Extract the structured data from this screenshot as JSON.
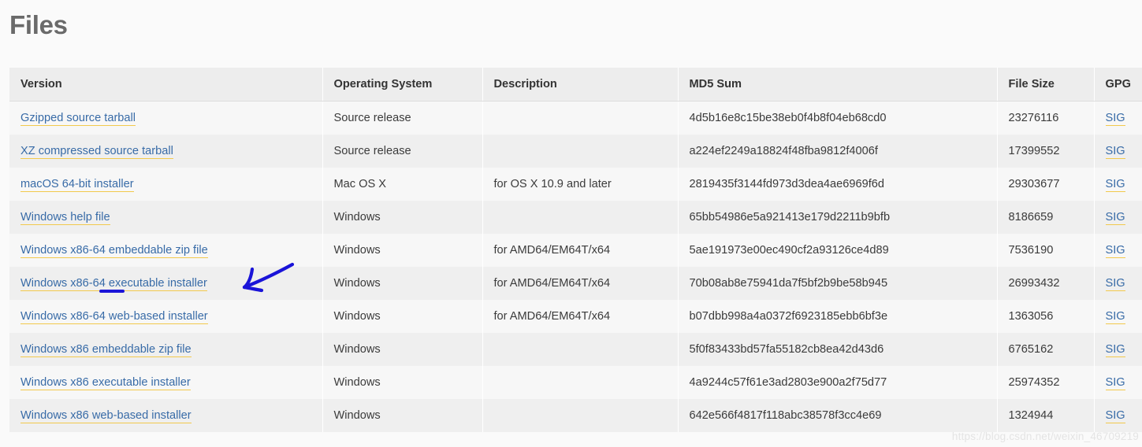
{
  "page": {
    "title": "Files",
    "watermark": "https://blog.csdn.net/weixin_46709219"
  },
  "table": {
    "columns": [
      "Version",
      "Operating System",
      "Description",
      "MD5 Sum",
      "File Size",
      "GPG"
    ],
    "rows": [
      {
        "version": "Gzipped source tarball",
        "os": "Source release",
        "description": "",
        "md5": "4d5b16e8c15be38eb0f4b8f04eb68cd0",
        "size": "23276116",
        "gpg": "SIG"
      },
      {
        "version": "XZ compressed source tarball",
        "os": "Source release",
        "description": "",
        "md5": "a224ef2249a18824f48fba9812f4006f",
        "size": "17399552",
        "gpg": "SIG"
      },
      {
        "version": "macOS 64-bit installer",
        "os": "Mac OS X",
        "description": "for OS X 10.9 and later",
        "md5": "2819435f3144fd973d3dea4ae6969f6d",
        "size": "29303677",
        "gpg": "SIG"
      },
      {
        "version": "Windows help file",
        "os": "Windows",
        "description": "",
        "md5": "65bb54986e5a921413e179d2211b9bfb",
        "size": "8186659",
        "gpg": "SIG"
      },
      {
        "version": "Windows x86-64 embeddable zip file",
        "os": "Windows",
        "description": "for AMD64/EM64T/x64",
        "md5": "5ae191973e00ec490cf2a93126ce4d89",
        "size": "7536190",
        "gpg": "SIG"
      },
      {
        "version": "Windows x86-64 executable installer",
        "os": "Windows",
        "description": "for AMD64/EM64T/x64",
        "md5": "70b08ab8e75941da7f5bf2b9be58b945",
        "size": "26993432",
        "gpg": "SIG"
      },
      {
        "version": "Windows x86-64 web-based installer",
        "os": "Windows",
        "description": "for AMD64/EM64T/x64",
        "md5": "b07dbb998a4a0372f6923185ebb6bf3e",
        "size": "1363056",
        "gpg": "SIG"
      },
      {
        "version": "Windows x86 embeddable zip file",
        "os": "Windows",
        "description": "",
        "md5": "5f0f83433bd57fa55182cb8ea42d43d6",
        "size": "6765162",
        "gpg": "SIG"
      },
      {
        "version": "Windows x86 executable installer",
        "os": "Windows",
        "description": "",
        "md5": "4a9244c57f61e3ad2803e900a2f75d77",
        "size": "25974352",
        "gpg": "SIG"
      },
      {
        "version": "Windows x86 web-based installer",
        "os": "Windows",
        "description": "",
        "md5": "642e566f4817f118abc38578f3cc4e69",
        "size": "1324944",
        "gpg": "SIG"
      }
    ]
  },
  "annotation": {
    "arrow_color": "#1a14d8",
    "target_row_index": 5,
    "target_text": "Windows x86-64 executable installer"
  },
  "colors": {
    "link": "#386ba7",
    "link_underline": "#f2c94c",
    "header_bg": "#ededed",
    "row_odd_bg": "#f7f7f7",
    "row_even_bg": "#efefef",
    "title": "#6a6a6a"
  }
}
